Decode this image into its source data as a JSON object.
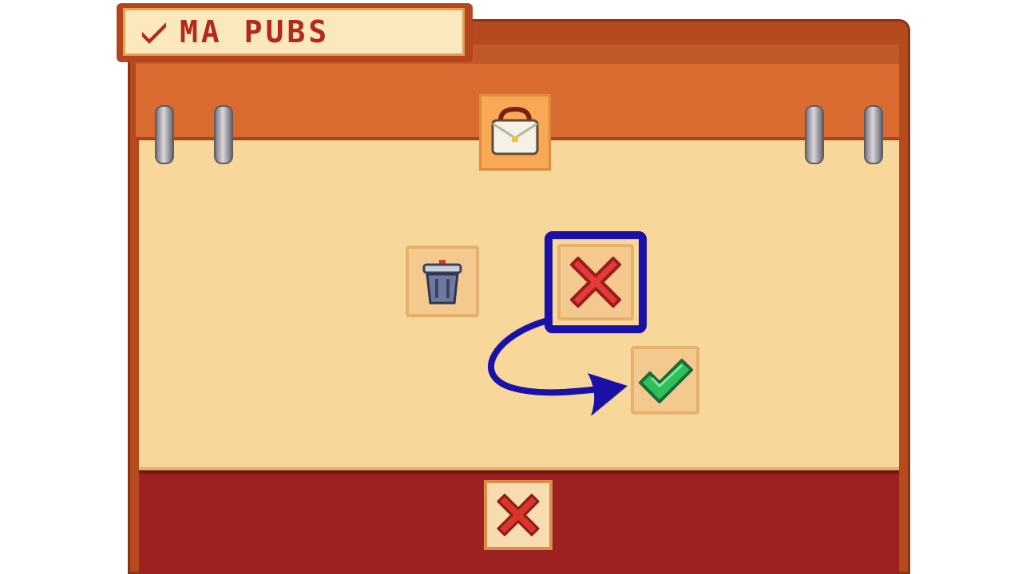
{
  "menu": {
    "title": "MA PUBS",
    "title_icon": "checkmark-icon"
  },
  "category_icon": "bag-icon",
  "actions": {
    "delete_icon": "trash-can-icon",
    "reject_icon": "red-x-icon",
    "accept_icon": "green-check-icon"
  },
  "footer": {
    "close_icon": "close-x-icon"
  },
  "colors": {
    "highlight": "#1a12a8",
    "title_text": "#b12a1a",
    "paper": "#f7d89a",
    "frame": "#b54a1f",
    "footer": "#9b221e"
  }
}
